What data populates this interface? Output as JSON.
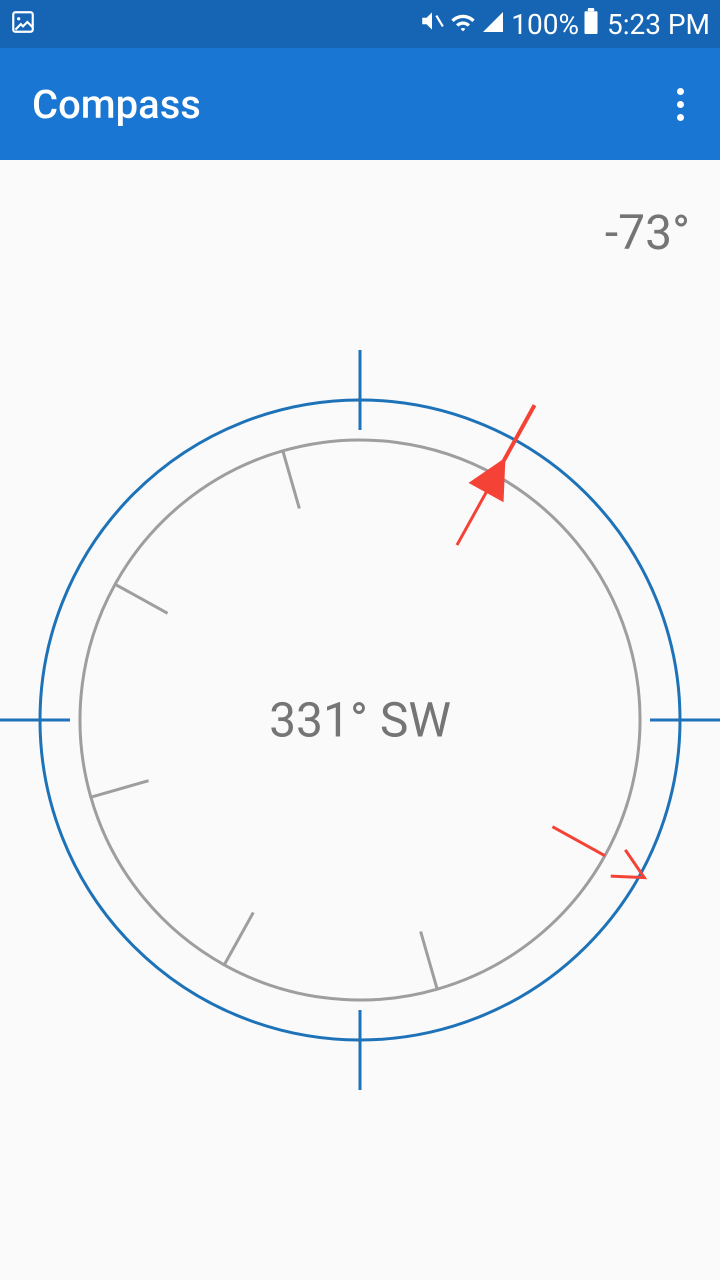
{
  "status": {
    "battery_pct": "100%",
    "time": "5:23 PM"
  },
  "appbar": {
    "title": "Compass"
  },
  "compass": {
    "declination": "-73°",
    "heading_text": "331° SW",
    "heading_deg": 331,
    "rotation_offset_deg": 29,
    "colors": {
      "outer_ring": "#1e73b8",
      "inner_ring": "#9e9e9e",
      "north": "#f44336",
      "tick": "#9e9e9e",
      "crosshair": "#1e73b8"
    }
  }
}
